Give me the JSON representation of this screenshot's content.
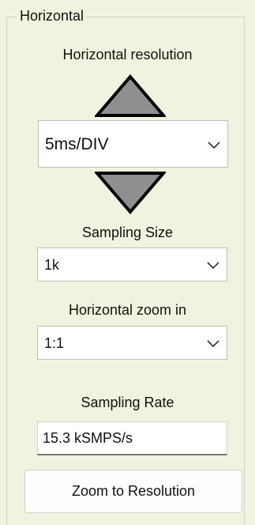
{
  "group": {
    "title": "Horizontal"
  },
  "horizontal_resolution": {
    "label": "Horizontal resolution",
    "value": "5ms/DIV",
    "increase_icon": "triangle-up-icon",
    "decrease_icon": "triangle-down-icon",
    "dropdown_icon": "chevron-down-icon"
  },
  "sampling_size": {
    "label": "Sampling Size",
    "value": "1k"
  },
  "horizontal_zoom": {
    "label": "Horizontal zoom in",
    "value": "1:1"
  },
  "sampling_rate": {
    "label": "Sampling Rate",
    "value": "15.3 kSMPS/s"
  },
  "actions": {
    "zoom_label": "Zoom to Resolution"
  },
  "colors": {
    "panel_background": "#f2f2e0",
    "arrow_fill": "#8f8f8f",
    "arrow_stroke": "#000000"
  }
}
